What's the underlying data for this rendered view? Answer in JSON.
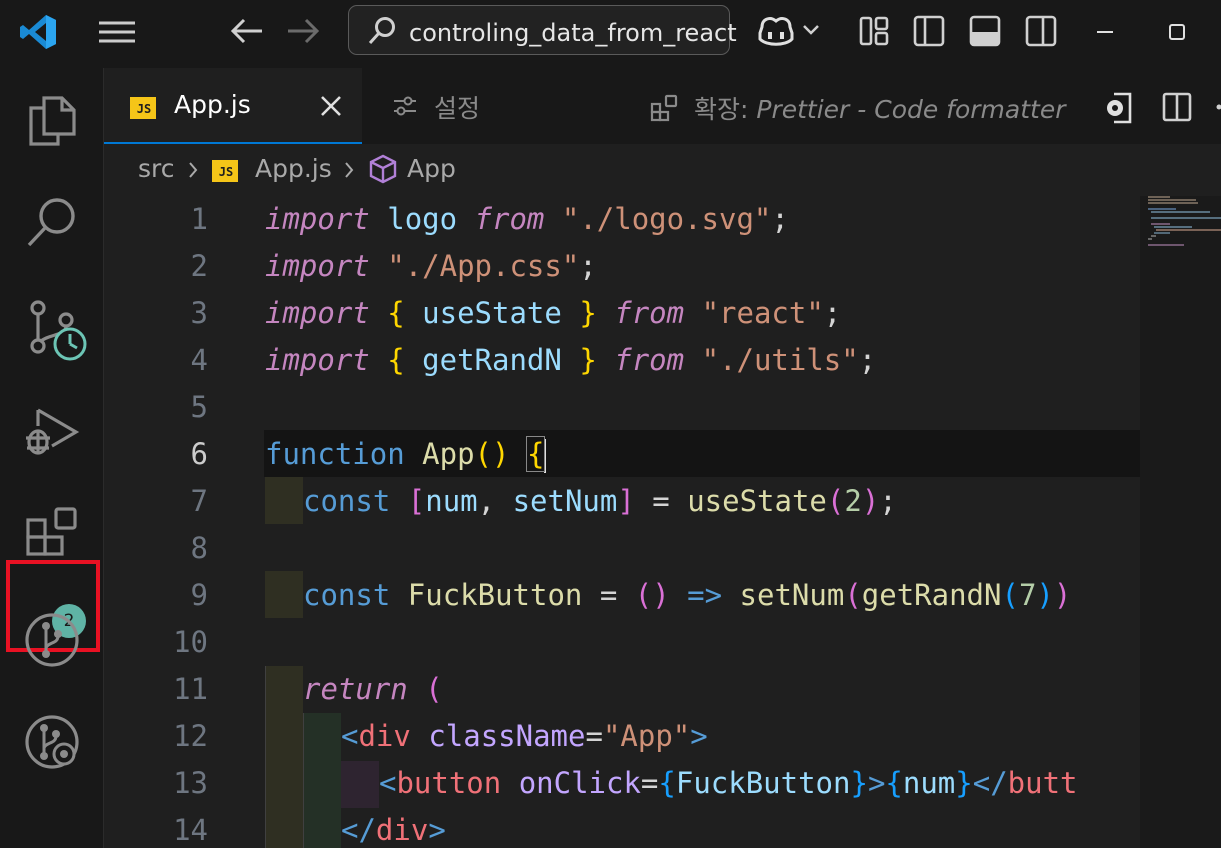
{
  "titlebar": {
    "search_text": "controling_data_from_react"
  },
  "activity_bar": {
    "extensions_badge": "2"
  },
  "tabs": {
    "active_badge": "JS",
    "active_label": "App.js",
    "settings_label": "설정",
    "ext_prefix": "확장: ",
    "ext_name": "Prettier - Code formatter"
  },
  "breadcrumb": {
    "folder": "src",
    "file_badge": "JS",
    "file": "App.js",
    "symbol": "App"
  },
  "editor": {
    "active_line": "6",
    "line_numbers": [
      "1",
      "2",
      "3",
      "4",
      "5",
      "6",
      "7",
      "8",
      "9",
      "10",
      "11",
      "12",
      "13",
      "14"
    ],
    "code": {
      "l1": {
        "import": "import",
        "name": "logo",
        "from": "from",
        "path": "\"./logo.svg\"",
        "semi": ";"
      },
      "l2": {
        "import": "import",
        "path": "\"./App.css\"",
        "semi": ";"
      },
      "l3": {
        "import": "import",
        "ob": "{",
        "name": "useState",
        "cb": "}",
        "from": "from",
        "path": "\"react\"",
        "semi": ";"
      },
      "l4": {
        "import": "import",
        "ob": "{",
        "name": "getRandN",
        "cb": "}",
        "from": "from",
        "path": "\"./utils\"",
        "semi": ";"
      },
      "l6": {
        "function": "function",
        "name": "App",
        "parens": "()",
        "ob": "{"
      },
      "l7": {
        "const": "const",
        "ob": "[",
        "a": "num",
        "comma": ", ",
        "b": "setNum",
        "cb": "]",
        "eq": " = ",
        "fn": "useState",
        "op": "(",
        "arg": "2",
        "cp": ")",
        "semi": ";"
      },
      "l9": {
        "const": "const",
        "name": "FuckButton",
        "eq": " = ",
        "parens": "()",
        "arrow": " => ",
        "fn": "setNum",
        "op": "(",
        "fn2": "getRandN",
        "op2": "(",
        "arg": "7",
        "cp2": ")",
        "cp": ")"
      },
      "l11": {
        "return": "return",
        "op": "("
      },
      "l12": {
        "lt": "<",
        "tag": "div",
        "attr": "className",
        "eq": "=",
        "val": "\"App\"",
        "gt": ">"
      },
      "l13": {
        "lt": "<",
        "tag": "button",
        "attr": "onClick",
        "eq": "=",
        "ob": "{",
        "val": "FuckButton",
        "cb": "}",
        "gt": ">",
        "ob2": "{",
        "var": "num",
        "cb2": "}",
        "lt2": "</",
        "tag2": "butt"
      },
      "l14": {
        "lt": "</",
        "tag": "div",
        "gt": ">"
      }
    }
  }
}
